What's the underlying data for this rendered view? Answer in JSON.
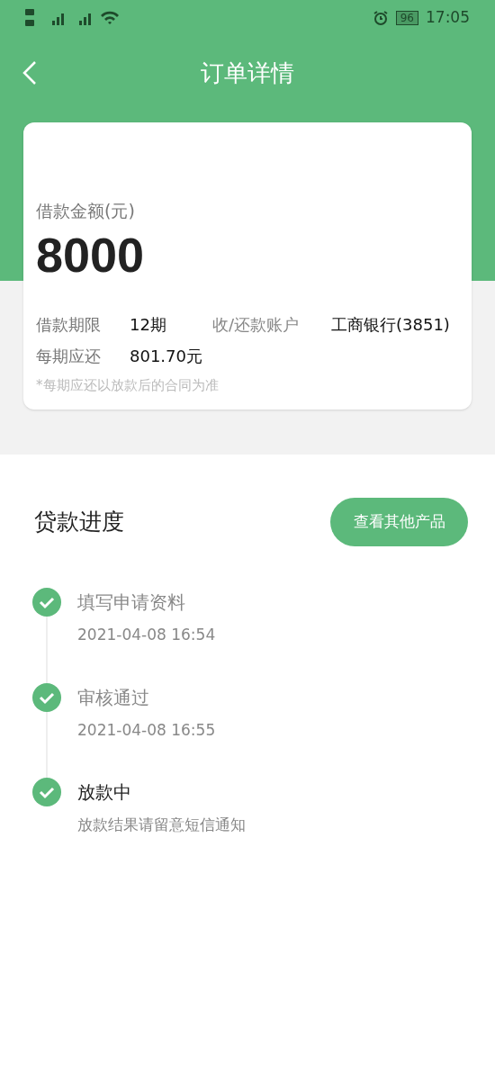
{
  "status_bar": {
    "time": "17:05",
    "battery": "96"
  },
  "header": {
    "title": "订单详情"
  },
  "loan": {
    "amount_label": "借款金额(元)",
    "amount": "8000",
    "details": [
      {
        "label": "借款期限",
        "value": "12期"
      },
      {
        "label": "收/还款账户",
        "value": "工商银行(3851)"
      },
      {
        "label": "每期应还",
        "value": "801.70元"
      }
    ],
    "note": "*每期应还以放款后的合同为准"
  },
  "progress": {
    "title": "贷款进度",
    "button": "查看其他产品",
    "steps": [
      {
        "title": "填写申请资料",
        "subtitle": "2021-04-08 16:54",
        "current": false
      },
      {
        "title": "审核通过",
        "subtitle": "2021-04-08 16:55",
        "current": false
      },
      {
        "title": "放款中",
        "subtitle": "放款结果请留意短信通知",
        "current": true
      }
    ]
  }
}
